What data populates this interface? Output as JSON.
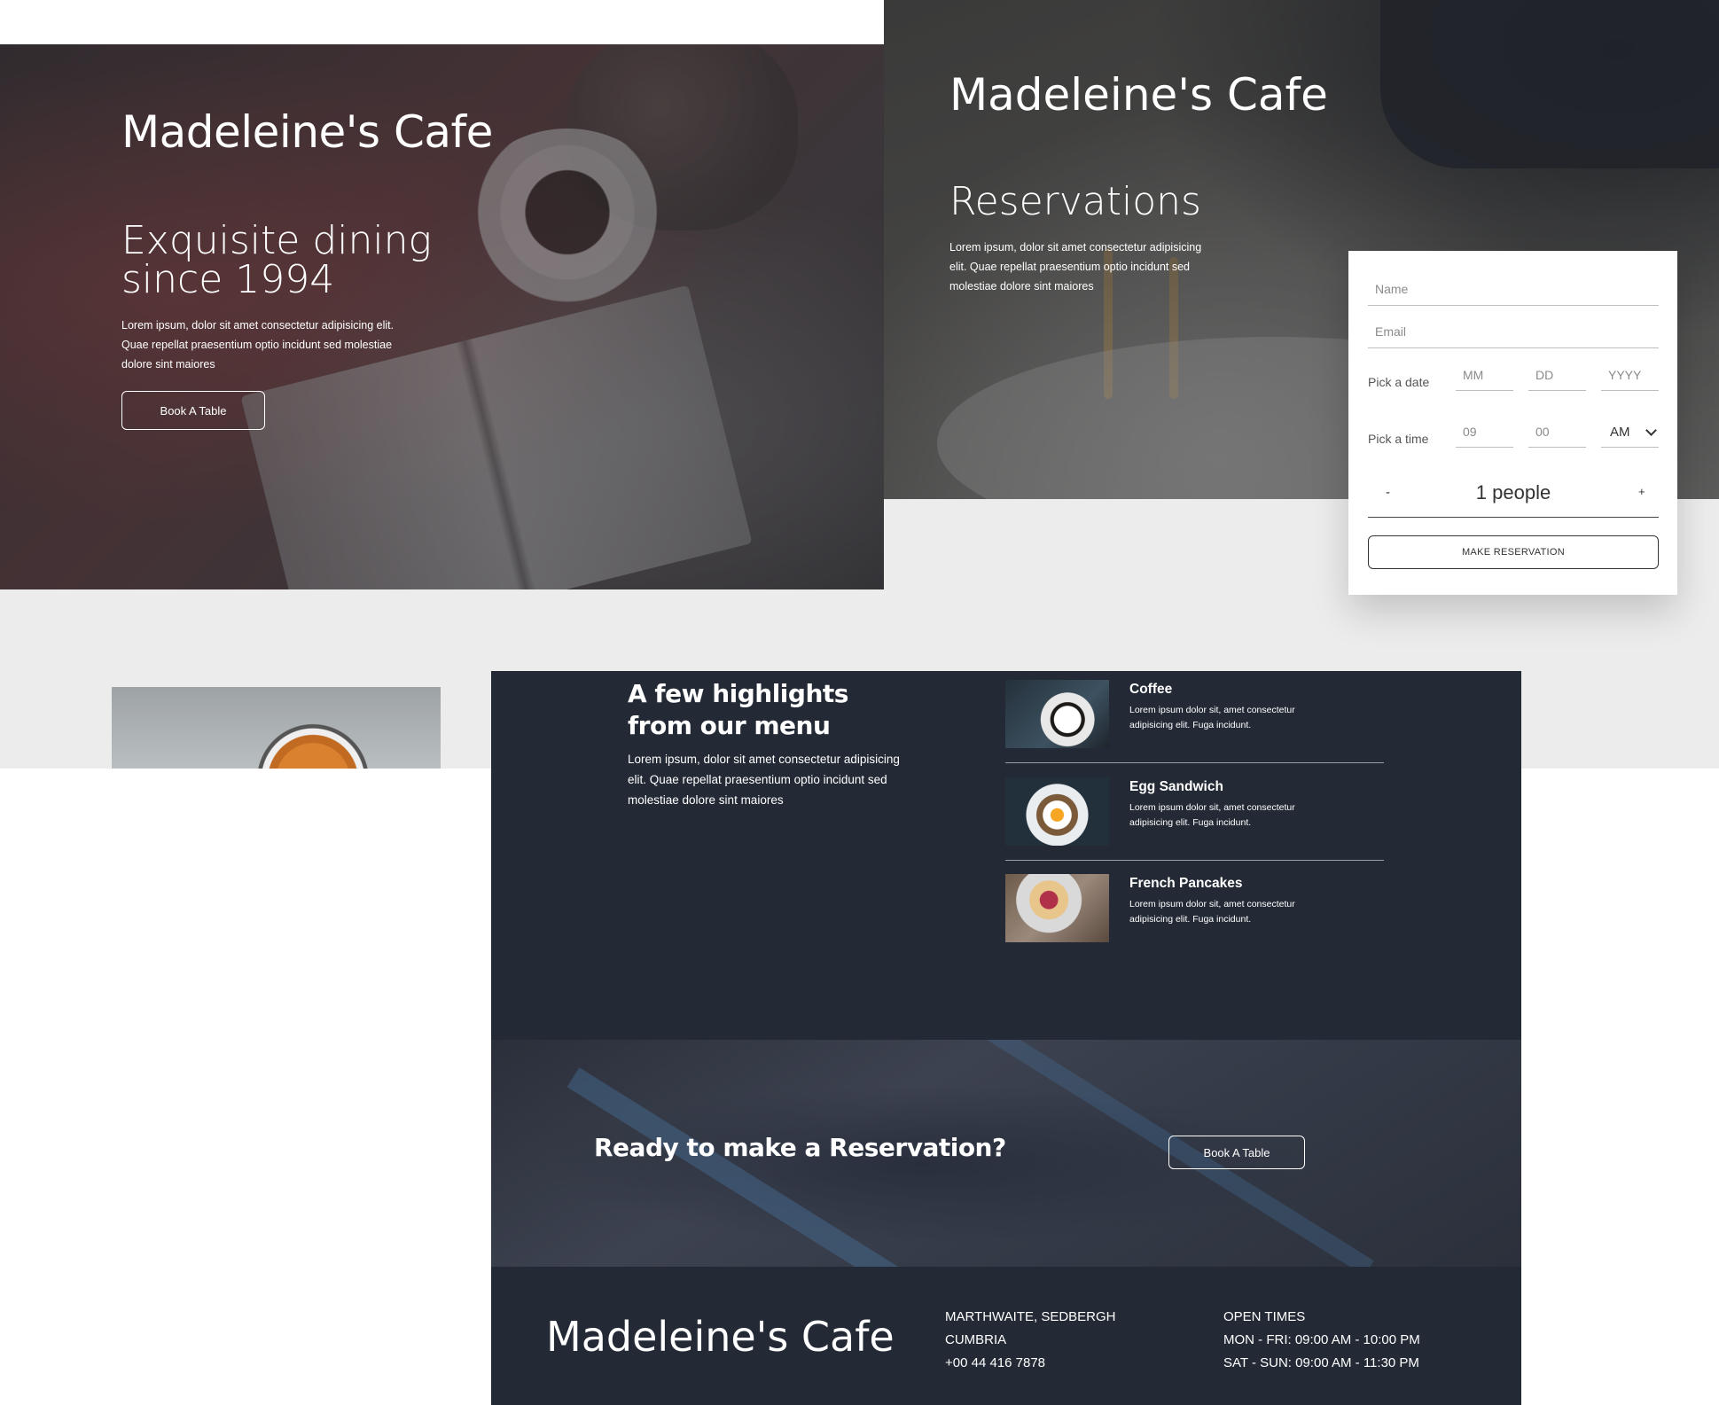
{
  "brand": "Madeleine's Cafe",
  "hero": {
    "title": "Madeleine's Cafe",
    "tagline": "Exquisite dining since 1994",
    "description": "Lorem ipsum, dolor sit amet consectetur adipisicing elit. Quae repellat praesentium optio incidunt sed molestiae dolore sint maiores",
    "button": "Book A Table"
  },
  "reservations": {
    "title": "Madeleine's Cafe",
    "heading": "Reservations",
    "description": "Lorem ipsum, dolor sit amet consectetur adipisicing elit. Quae repellat praesentium optio incidunt sed molestiae dolore sint maiores",
    "form": {
      "name_placeholder": "Name",
      "email_placeholder": "Email",
      "date_label": "Pick a date",
      "month_placeholder": "MM",
      "day_placeholder": "DD",
      "year_placeholder": "YYYY",
      "time_label": "Pick a time",
      "hour_placeholder": "09",
      "minute_placeholder": "00",
      "ampm": "AM",
      "minus": "-",
      "people": "1 people",
      "plus": "+",
      "submit": "MAKE RESERVATION"
    }
  },
  "highlights": {
    "title": "A few highlights from our menu",
    "description": "Lorem ipsum, dolor sit amet consectetur adipisicing elit. Quae repellat praesentium optio incidunt sed molestiae dolore sint maiores",
    "items": [
      {
        "name": "Coffee",
        "text": "Lorem ipsum dolor sit, amet consectetur adipisicing elit. Fuga incidunt."
      },
      {
        "name": "Egg Sandwich",
        "text": "Lorem ipsum dolor sit, amet consectetur adipisicing elit. Fuga incidunt."
      },
      {
        "name": "French Pancakes",
        "text": "Lorem ipsum dolor sit, amet consectetur adipisicing elit. Fuga incidunt."
      }
    ]
  },
  "cta": {
    "title": "Ready to make a Reservation?",
    "button": "Book A Table"
  },
  "footer": {
    "brand": "Madeleine's Cafe",
    "address": [
      "MARTHWAITE, SEDBERGH",
      "CUMBRIA",
      "+00 44 416 7878"
    ],
    "times": [
      "OPEN TIMES",
      "MON - FRI: 09:00 AM - 10:00 PM",
      "SAT - SUN: 09:00 AM - 11:30 PM"
    ]
  },
  "colors": {
    "dark_navy": "#232a36",
    "light_gray": "#ececec",
    "text_on_dark": "#ffffff"
  }
}
